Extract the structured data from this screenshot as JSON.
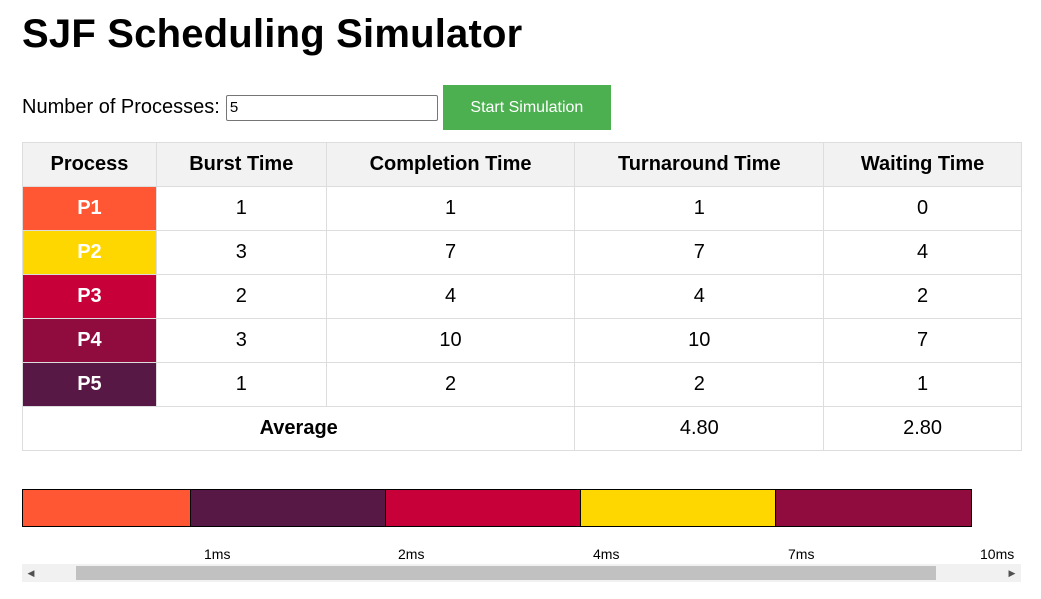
{
  "title": "SJF Scheduling Simulator",
  "controls": {
    "num_label": "Number of Processes:",
    "num_value": "5",
    "start_label": "Start Simulation"
  },
  "table": {
    "headers": [
      "Process",
      "Burst Time",
      "Completion Time",
      "Turnaround Time",
      "Waiting Time"
    ],
    "rows": [
      {
        "process": "P1",
        "burst": "1",
        "completion": "1",
        "turnaround": "1",
        "waiting": "0",
        "color": "#ff5733"
      },
      {
        "process": "P2",
        "burst": "3",
        "completion": "7",
        "turnaround": "7",
        "waiting": "4",
        "color": "#ffd700"
      },
      {
        "process": "P3",
        "burst": "2",
        "completion": "4",
        "turnaround": "4",
        "waiting": "2",
        "color": "#c70039"
      },
      {
        "process": "P4",
        "burst": "3",
        "completion": "10",
        "turnaround": "10",
        "waiting": "7",
        "color": "#900c3f"
      },
      {
        "process": "P5",
        "burst": "1",
        "completion": "2",
        "turnaround": "2",
        "waiting": "1",
        "color": "#581845"
      }
    ],
    "average": {
      "label": "Average",
      "turnaround": "4.80",
      "waiting": "2.80"
    }
  },
  "gantt": {
    "blocks": [
      {
        "color": "#ff5733"
      },
      {
        "color": "#581845"
      },
      {
        "color": "#c70039"
      },
      {
        "color": "#ffd700"
      },
      {
        "color": "#900c3f"
      }
    ],
    "ticks": [
      "1ms",
      "2ms",
      "4ms",
      "7ms",
      "10ms"
    ]
  },
  "scrollbar": {
    "left_icon": "arrow-left-icon",
    "right_icon": "arrow-right-icon"
  }
}
